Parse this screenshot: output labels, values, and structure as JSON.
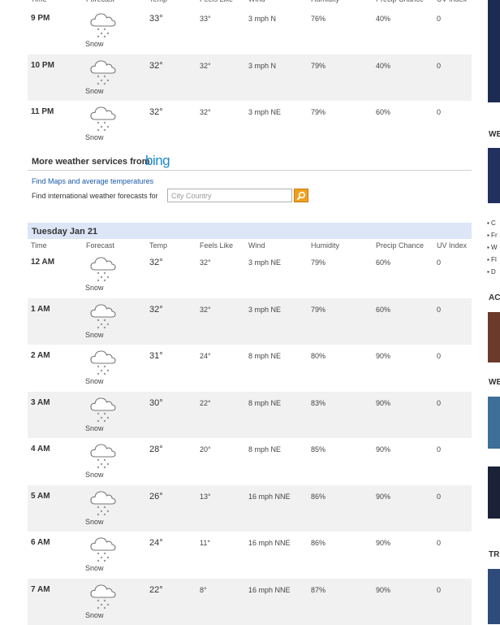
{
  "columns": {
    "time": "Time",
    "forecast": "Forecast",
    "temp": "Temp",
    "feels": "Feels Like",
    "wind": "Wind",
    "humidity": "Humidity",
    "precip": "Precip Chance",
    "uv": "UV Index"
  },
  "evening_rows": [
    {
      "time": "9 PM",
      "condition": "Snow",
      "temp": "33°",
      "feels": "33°",
      "wind": "3 mph N",
      "humidity": "76%",
      "precip": "40%",
      "uv": "0"
    },
    {
      "time": "10 PM",
      "condition": "Snow",
      "temp": "32°",
      "feels": "32°",
      "wind": "3 mph N",
      "humidity": "79%",
      "precip": "40%",
      "uv": "0"
    },
    {
      "time": "11 PM",
      "condition": "Snow",
      "temp": "32°",
      "feels": "32°",
      "wind": "3 mph NE",
      "humidity": "79%",
      "precip": "60%",
      "uv": "0"
    }
  ],
  "more_services": {
    "title": "More weather services from",
    "brand": "bing",
    "maps_link": "Find Maps and average temperatures",
    "intl_label": "Find international weather forecasts for",
    "city_placeholder": "City Country"
  },
  "day2": {
    "label": "Tuesday Jan 21",
    "rows": [
      {
        "time": "12 AM",
        "condition": "Snow",
        "temp": "32°",
        "feels": "32°",
        "wind": "3 mph NE",
        "humidity": "79%",
        "precip": "60%",
        "uv": "0"
      },
      {
        "time": "1 AM",
        "condition": "Snow",
        "temp": "32°",
        "feels": "32°",
        "wind": "3 mph NE",
        "humidity": "79%",
        "precip": "60%",
        "uv": "0"
      },
      {
        "time": "2 AM",
        "condition": "Snow",
        "temp": "31°",
        "feels": "24°",
        "wind": "8 mph NE",
        "humidity": "80%",
        "precip": "90%",
        "uv": "0"
      },
      {
        "time": "3 AM",
        "condition": "Snow",
        "temp": "30°",
        "feels": "22°",
        "wind": "8 mph NE",
        "humidity": "83%",
        "precip": "90%",
        "uv": "0"
      },
      {
        "time": "4 AM",
        "condition": "Snow",
        "temp": "28°",
        "feels": "20°",
        "wind": "8 mph NE",
        "humidity": "85%",
        "precip": "90%",
        "uv": "0"
      },
      {
        "time": "5 AM",
        "condition": "Snow",
        "temp": "26°",
        "feels": "13°",
        "wind": "16 mph NNE",
        "humidity": "86%",
        "precip": "90%",
        "uv": "0"
      },
      {
        "time": "6 AM",
        "condition": "Snow",
        "temp": "24°",
        "feels": "11°",
        "wind": "16 mph NNE",
        "humidity": "86%",
        "precip": "90%",
        "uv": "0"
      },
      {
        "time": "7 AM",
        "condition": "Snow",
        "temp": "22°",
        "feels": "8°",
        "wind": "16 mph NNE",
        "humidity": "87%",
        "precip": "90%",
        "uv": "0"
      }
    ]
  },
  "sidebar": {
    "heading_1": "WE",
    "bullets": [
      "C",
      "Fr",
      "W",
      "Fl",
      "D"
    ],
    "heading_2": "AC",
    "heading_3": "WE",
    "heading_4": "TR"
  },
  "icon": "snow-cloud-icon",
  "colors": {
    "header_bg": "#dce6f7",
    "alt_row": "#f1f1f1",
    "link": "#1a5aa8",
    "bing": "#1a88c9",
    "search_btn": "#f0a020"
  }
}
